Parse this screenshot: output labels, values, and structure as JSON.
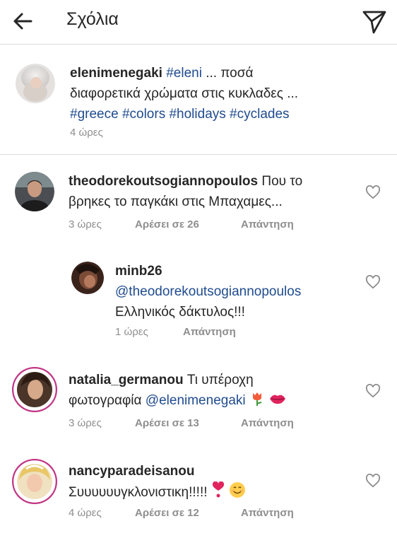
{
  "header": {
    "title": "Σχόλια"
  },
  "caption": {
    "username": "elenimenegaki",
    "hashtag1": "#eleni",
    "line1_rest": " ... ποσά",
    "line2": "διαφορετικά χρώματα στις κυκλαδες ...",
    "tags": [
      "#greece",
      "#colors",
      "#holidays",
      "#cyclades"
    ],
    "time": "4 ώρες"
  },
  "comments": [
    {
      "username": "theodorekoutsogiannopoulos",
      "text1": " Που το",
      "text2": "βρηκες το παγκάκι στις Μπαχαμες...",
      "time": "3 ώρες",
      "likes": "Αρέσει σε 26",
      "reply": "Απάντηση"
    },
    {
      "username": "minb26",
      "mention": "@theodorekoutsogiannopoulos",
      "text": "Ελληνικός δάκτυλος!!!",
      "time": "1 ώρες",
      "reply": "Απάντηση"
    },
    {
      "username": "natalia_germanou",
      "text1": " Τι υπέροχη",
      "text2": "φωτογραφία ",
      "mention": "@elenimenegaki",
      "time": "3 ώρες",
      "likes": "Αρέσει σε 13",
      "reply": "Απάντηση"
    },
    {
      "username": "nancyparadeisanou",
      "text": "Συυυυυυγκλονιστικη!!!!!",
      "time": "4 ώρες",
      "likes": "Αρέσει σε 12",
      "reply": "Απάντηση"
    }
  ],
  "icons": {
    "back": "arrow-left-icon",
    "send": "paper-plane-icon",
    "like": "heart-outline-icon"
  },
  "colors": {
    "hashtag": "#1f4b8e",
    "meta": "#8e8e8e",
    "story_ring": "#c13584"
  }
}
